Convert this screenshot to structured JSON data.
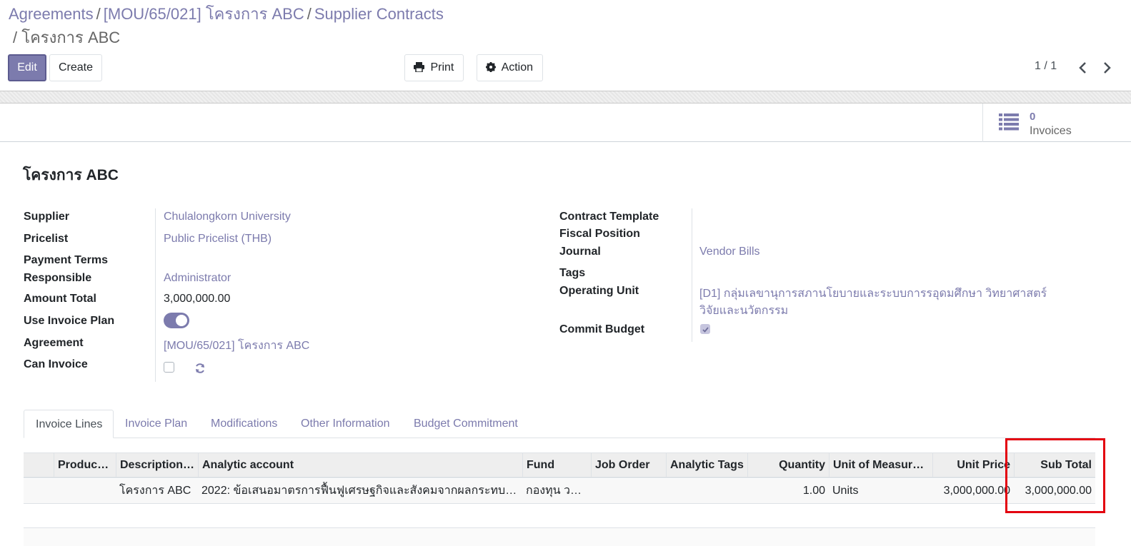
{
  "breadcrumb": {
    "items": [
      "Agreements",
      "[MOU/65/021] โครงการ ABC",
      "Supplier Contracts"
    ],
    "current": "โครงการ ABC",
    "separator": "/"
  },
  "toolbar": {
    "edit_label": "Edit",
    "create_label": "Create",
    "print_label": "Print",
    "action_label": "Action",
    "pager": "1 / 1"
  },
  "smart_buttons": {
    "invoices_count": "0",
    "invoices_label": "Invoices"
  },
  "record": {
    "title": "โครงการ ABC",
    "left_fields": [
      {
        "label": "Supplier",
        "value": "Chulalongkorn University"
      },
      {
        "label": "Pricelist",
        "value": "Public Pricelist (THB)"
      },
      {
        "label": "Payment Terms",
        "value": ""
      },
      {
        "label": "Responsible",
        "value": "Administrator"
      },
      {
        "label": "Amount Total",
        "value": "3,000,000.00"
      },
      {
        "label": "Use Invoice Plan",
        "value": "on"
      },
      {
        "label": "Agreement",
        "value": "[MOU/65/021] โครงการ ABC"
      },
      {
        "label": "Can Invoice",
        "value": "unchecked"
      }
    ],
    "right_fields": [
      {
        "label": "Contract Template",
        "value": ""
      },
      {
        "label": "Fiscal Position",
        "value": ""
      },
      {
        "label": "Journal",
        "value": "Vendor Bills"
      },
      {
        "label": "Tags",
        "value": ""
      },
      {
        "label": "Operating Unit",
        "value_line1": "[D1] กลุ่มเลขานุการสภานโยบายและระบบการรอุดมศึกษา วิทยาศาสตร์",
        "value_line2": "วิจัยและนวัตกรรม"
      },
      {
        "label": "Commit Budget",
        "value": "checked"
      }
    ]
  },
  "tabs": [
    {
      "label": "Invoice Lines",
      "active": true
    },
    {
      "label": "Invoice Plan",
      "active": false
    },
    {
      "label": "Modifications",
      "active": false
    },
    {
      "label": "Other Information",
      "active": false
    },
    {
      "label": "Budget Commitment",
      "active": false
    }
  ],
  "table": {
    "columns": [
      "Produc…",
      "Description…",
      "Analytic account",
      "Fund",
      "Job Order",
      "Analytic Tags",
      "Quantity",
      "Unit of Measur…",
      "Unit Price",
      "Sub Total"
    ],
    "rows": [
      [
        "",
        "โครงการ ABC",
        "2022: ข้อเสนอมาตรการฟื้นฟูเศรษฐกิจและสังคมจากผลกระทบ…",
        "กองทุน ววน.",
        "",
        "",
        "1.00",
        "Units",
        "3,000,000.00",
        "3,000,000.00"
      ]
    ]
  },
  "colors": {
    "accent": "#7c7bad",
    "highlight": "#e3000f"
  }
}
